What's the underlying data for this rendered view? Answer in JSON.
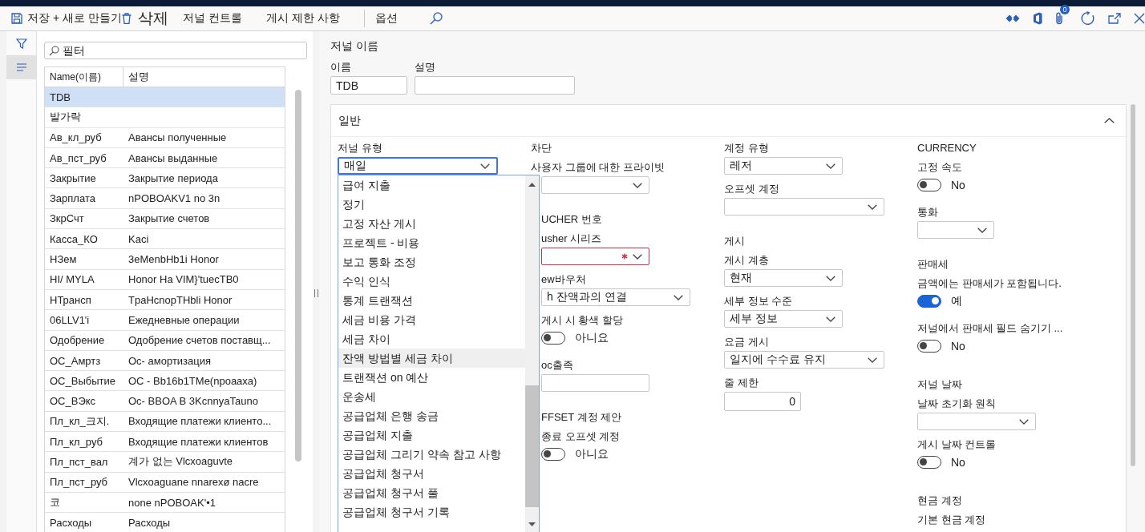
{
  "toolbar": {
    "actions": [
      {
        "kind": "save",
        "label": "저장"
      },
      {
        "kind": "new",
        "label": "+ 새로 만들기"
      },
      {
        "kind": "delete",
        "label": "삭제"
      },
      {
        "kind": "plain",
        "label": "저널 컨트롤"
      },
      {
        "kind": "plain",
        "label": "게시 제한 사항"
      },
      {
        "kind": "separator"
      },
      {
        "kind": "plain",
        "label": "옵션"
      },
      {
        "kind": "search"
      }
    ],
    "attachment_badge": "0"
  },
  "nav": [
    {
      "kind": "filter",
      "selected": false
    },
    {
      "kind": "list",
      "selected": true
    }
  ],
  "list": {
    "filter": {
      "placeholder": "필터"
    },
    "columns": [
      "Name(이름)",
      "설명"
    ],
    "rows": [
      {
        "name": "TDB",
        "selected": true
      },
      {
        "name": "발가락",
        "selected": false
      },
      {
        "name": "Ав_кл_руб",
        "description": "Авансы полученные",
        "selected": false
      },
      {
        "name": "Ав_пст_руб",
        "description": "Авансы выданные",
        "selected": false
      },
      {
        "name": "Закрытие",
        "description": "Закрытие периода",
        "selected": false
      },
      {
        "name": "Зарплата",
        "description": "nPOBOAKV1 no 3n",
        "selected": false
      },
      {
        "name": "ЗкрСчт",
        "description": "Закрытие счетов",
        "selected": false
      },
      {
        "name": "Касса_КО",
        "description": "Kaci",
        "selected": false
      },
      {
        "name": "НЗем",
        "description": "3eMenbHb1i Honor",
        "selected": false
      },
      {
        "name": "HI/ MYLA",
        "description": "Honor Ha VIM}'tuecTB0",
        "selected": false
      },
      {
        "name": "НТрансп",
        "description": "TpaHcnopTHbli Honor",
        "selected": false
      },
      {
        "name": "06LLV1'i",
        "description": "Ежедневные операции",
        "selected": false
      },
      {
        "name": "Одобрение",
        "description": "Одобрение счетов поставщ...",
        "selected": false
      },
      {
        "name": "ОС_Амртз",
        "description": "Oc- амортизация",
        "selected": false
      },
      {
        "name": "ОС_Выбытие",
        "description": "OC - Bb16b1TMe(npoaaxa)",
        "selected": false
      },
      {
        "name": "ОС_ВЭкс",
        "description": "Oc- BBOA B 3KcnnyaTauno",
        "selected": false
      },
      {
        "name": "Пл_кл_크지.",
        "description": "Входящие платежи клиенто...",
        "selected": false
      },
      {
        "name": "Пл_кл_руб",
        "description": "Входящие платежи клиентов",
        "selected": false
      },
      {
        "name": "Пл_пст_вал",
        "description": "계가 없는 Vlcxoaguvte",
        "selected": false
      },
      {
        "name": "Пл_пст_руб",
        "description": "Vlcxoaguane nnarexø nacre",
        "selected": false
      },
      {
        "name": "코",
        "description": "none nPOBOAK'•1",
        "selected": false
      },
      {
        "name": "Расходы",
        "description": "Расходы",
        "selected": false
      }
    ]
  },
  "journal": {
    "title": "저널 이름",
    "fields": [
      {
        "label": "이름",
        "value": "TDB"
      },
      {
        "label": "설명"
      }
    ]
  },
  "section": {
    "title": "일반",
    "expanded": true,
    "columns": [
      {
        "items": [
          {
            "kind": "select",
            "label": "저널 유형",
            "value": "매일",
            "focused": true,
            "required": false,
            "open": true,
            "options": [
              {
                "label": "급여 지출",
                "highlighted": false
              },
              {
                "label": "정기",
                "highlighted": false
              },
              {
                "label": "고정 자산 게시",
                "highlighted": false
              },
              {
                "label": "프로젝트 - 비용",
                "highlighted": false
              },
              {
                "label": "보고 통화 조정",
                "highlighted": false
              },
              {
                "label": "수익 인식",
                "highlighted": false
              },
              {
                "label": "통계 트랜잭션",
                "highlighted": false
              },
              {
                "label": "세금 비용 가격",
                "highlighted": false
              },
              {
                "label": "세금 차이",
                "highlighted": false
              },
              {
                "label": "잔액 방법별 세금 차이",
                "highlighted": true
              },
              {
                "label": "트랜잭션 on 예산",
                "highlighted": false
              },
              {
                "label": "운송세",
                "highlighted": false
              },
              {
                "label": "공급업체 은행 송금",
                "highlighted": false
              },
              {
                "label": "공급업체 지출",
                "highlighted": false
              },
              {
                "label": "공급업체 그리기 약속 참고 사항",
                "highlighted": false
              },
              {
                "label": "공급업체 청구서",
                "highlighted": false
              },
              {
                "label": "공급업체 청구서 풀",
                "highlighted": false
              },
              {
                "label": "공급업체 청구서 기록",
                "highlighted": false
              }
            ]
          }
        ]
      },
      {
        "items": [
          {
            "kind": "heading",
            "text": "차단"
          },
          {
            "kind": "select",
            "label": "사용자 그룹에 대한 프라이빗",
            "focused": false,
            "required": false
          },
          {
            "kind": "heading",
            "text": "UCHER 번호"
          },
          {
            "kind": "select",
            "label": "usher 시리즈",
            "focused": false,
            "required": true
          },
          {
            "kind": "select",
            "label": "ew바우처",
            "value": "h 잔액과의 연결",
            "focused": false,
            "required": false
          },
          {
            "kind": "toggle",
            "label": "게시 시 황색 할당",
            "on": false,
            "state_text": "아니요"
          },
          {
            "kind": "text",
            "label": "oc출족"
          },
          {
            "kind": "heading",
            "text": "FFSET 계정 제안"
          },
          {
            "kind": "toggle",
            "label": "종료 오프셋 계정",
            "on": false,
            "state_text": "아니요"
          }
        ]
      },
      {
        "items": [
          {
            "kind": "select",
            "label": "계정 유형",
            "value": "레저",
            "focused": false,
            "required": false
          },
          {
            "kind": "select",
            "label": "오프셋 계정",
            "focused": false,
            "required": false
          },
          {
            "kind": "heading",
            "text": "게시"
          },
          {
            "kind": "select",
            "label": "게시 계층",
            "value": "현재",
            "focused": false,
            "required": false
          },
          {
            "kind": "select",
            "label": "세부 정보 수준",
            "value": "세부 정보",
            "focused": false,
            "required": false
          },
          {
            "kind": "select",
            "label": "요금 게시",
            "value": "일지에 수수료 유지",
            "focused": false,
            "required": false
          },
          {
            "kind": "number",
            "label": "줄 제한",
            "value": "0"
          }
        ]
      },
      {
        "items": [
          {
            "kind": "heading",
            "text": "CURRENCY"
          },
          {
            "kind": "toggle",
            "label": "고정 속도",
            "on": false,
            "state_text": "No"
          },
          {
            "kind": "select",
            "label": "통화",
            "focused": false,
            "required": false
          },
          {
            "kind": "heading",
            "text": "판매세"
          },
          {
            "kind": "toggle",
            "label": "금액에는 판매세가 포함됩니다.",
            "on": true,
            "state_text": "예"
          },
          {
            "kind": "toggle",
            "label": "저널에서 판매세 필드 숨기기 ...",
            "on": false,
            "state_text": "No"
          },
          {
            "kind": "heading",
            "text": "저널 날짜"
          },
          {
            "kind": "select",
            "label": "날짜 초기화 원칙",
            "focused": false,
            "required": false
          },
          {
            "kind": "toggle",
            "label": "게시 날짜 컨트롤",
            "on": false,
            "state_text": "No"
          },
          {
            "kind": "heading",
            "text": "현금 계정"
          },
          {
            "kind": "label",
            "text": "기본 현금 계정"
          }
        ]
      }
    ]
  }
}
